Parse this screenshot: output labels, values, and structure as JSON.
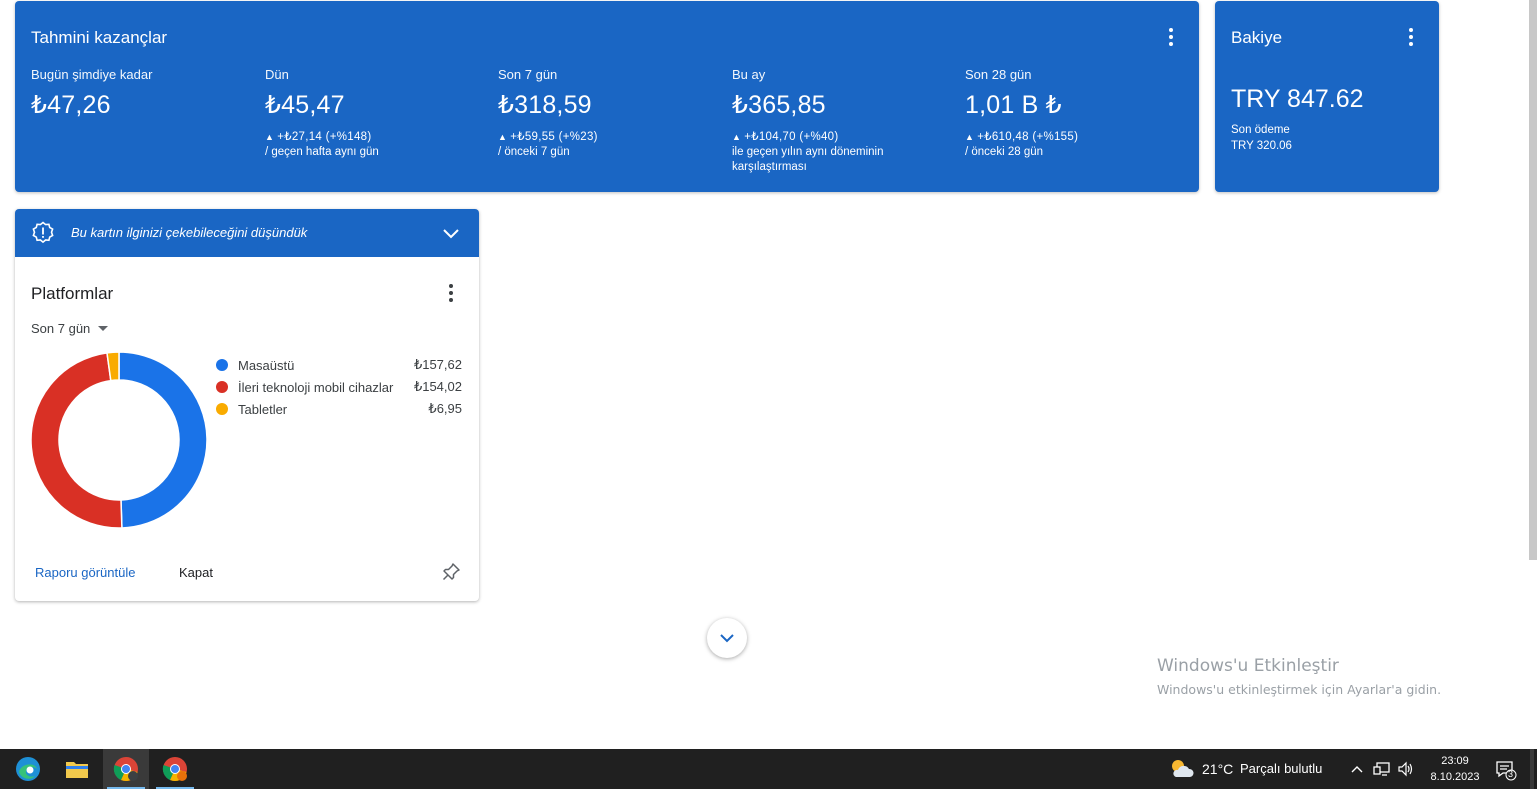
{
  "earnings": {
    "title": "Tahmini kazançlar",
    "metrics": [
      {
        "label": "Bugün şimdiye kadar",
        "value": "₺47,26",
        "delta": "",
        "note": ""
      },
      {
        "label": "Dün",
        "value": "₺45,47",
        "delta": "+₺27,14 (+%148)",
        "note": "/ geçen hafta aynı gün"
      },
      {
        "label": "Son 7 gün",
        "value": "₺318,59",
        "delta": "+₺59,55 (+%23)",
        "note": "/ önceki 7 gün"
      },
      {
        "label": "Bu ay",
        "value": "₺365,85",
        "delta": "+₺104,70 (+%40)",
        "note": "ile geçen yılın aynı döneminin karşılaştırması"
      },
      {
        "label": "Son 28 gün",
        "value": "1,01 B ₺",
        "delta": "+₺610,48 (+%155)",
        "note": "/ önceki 28 gün"
      }
    ],
    "delta_arrow": "▲"
  },
  "balance": {
    "title": "Bakiye",
    "value": "TRY 847.62",
    "last_payment_label": "Son ödeme",
    "last_payment_value": "TRY 320.06"
  },
  "suggestion": {
    "text": "Bu kartın ilginizi çekebileceğini düşündük"
  },
  "platforms": {
    "title": "Platformlar",
    "range": "Son 7 gün",
    "items": [
      {
        "name": "Masaüstü",
        "value": "₺157,62",
        "color": "#1a73e8",
        "amount": 157.62
      },
      {
        "name": "İleri teknoloji mobil cihazlar",
        "value": "₺154,02",
        "color": "#d93025",
        "amount": 154.02
      },
      {
        "name": "Tabletler",
        "value": "₺6,95",
        "color": "#f9ab00",
        "amount": 6.95
      }
    ],
    "view_report": "Raporu görüntüle",
    "close": "Kapat"
  },
  "watermark": {
    "title": "Windows'u Etkinleştir",
    "subtitle": "Windows'u etkinleştirmek için Ayarlar'a gidin."
  },
  "taskbar": {
    "apps": [
      "edge-icon",
      "file-explorer-icon",
      "chrome-icon",
      "chrome-profile-icon"
    ],
    "weather_temp": "21°C",
    "weather_text": "Parçalı bulutlu",
    "time": "23:09",
    "date": "8.10.2023",
    "notification_count": "3"
  }
}
